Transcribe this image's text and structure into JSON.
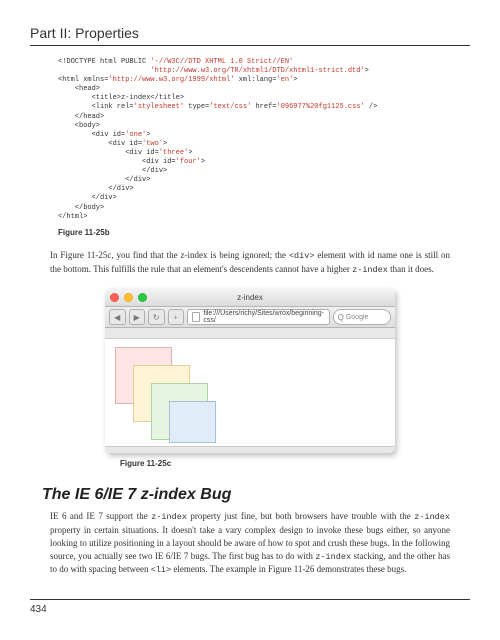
{
  "header": {
    "title": "Part II: Properties"
  },
  "code_listing": {
    "lines": [
      {
        "pre": "<!DOCTYPE html PUBLIC ",
        "str": "'-//W3C//DTD XHTML 1.0 Strict//EN'",
        "post": ""
      },
      {
        "pre": "                      ",
        "str": "'http://www.w3.org/TR/xhtml1/DTD/xhtml1-strict.dtd'",
        "post": ">"
      },
      {
        "pre": "<html xmlns=",
        "str": "'http://www.w3.org/1999/xhtml'",
        "mid": " xml:lang=",
        "str2": "'en'",
        "post": ">"
      },
      {
        "pre": "    <head>",
        "str": "",
        "post": ""
      },
      {
        "pre": "        <title>z-index</title>",
        "str": "",
        "post": ""
      },
      {
        "pre": "        <link rel=",
        "str": "'stylesheet'",
        "mid": " type=",
        "str2": "'text/css'",
        "mid2": " href=",
        "str3": "'096977%20fg1125.css'",
        "post": " />"
      },
      {
        "pre": "    </head>",
        "str": "",
        "post": ""
      },
      {
        "pre": "    <body>",
        "str": "",
        "post": ""
      },
      {
        "pre": "        <div id=",
        "str": "'one'",
        "post": ">"
      },
      {
        "pre": "            <div id=",
        "str": "'two'",
        "post": ">"
      },
      {
        "pre": "                <div id=",
        "str": "'three'",
        "post": ">"
      },
      {
        "pre": "                    <div id=",
        "str": "'four'",
        "post": ">"
      },
      {
        "pre": "                    </div>",
        "str": "",
        "post": ""
      },
      {
        "pre": "                </div>",
        "str": "",
        "post": ""
      },
      {
        "pre": "            </div>",
        "str": "",
        "post": ""
      },
      {
        "pre": "        </div>",
        "str": "",
        "post": ""
      },
      {
        "pre": "    </body>",
        "str": "",
        "post": ""
      },
      {
        "pre": "</html>",
        "str": "",
        "post": ""
      }
    ]
  },
  "captions": {
    "fig_b": "Figure 11-25b",
    "fig_c": "Figure 11-25c"
  },
  "paragraphs": {
    "p1_a": "In Figure 11-25c, you find that the z-index is being ignored; the ",
    "p1_code1": "<div>",
    "p1_b": " element with id name one is still on the bottom. This fulfills the rule that an element's descendents cannot have a higher ",
    "p1_code2": "z-index",
    "p1_c": " than it does.",
    "p2_a": "IE 6 and IE 7 support the ",
    "p2_code1": "z-index",
    "p2_b": " property just fine, but both browsers have trouble with the ",
    "p2_code2": "z-index",
    "p2_c": " property in certain situations. It doesn't take a vary complex design to invoke these bugs either, so anyone looking to utilize positioning in a layout should be aware of how to spot and crush these bugs. In the following source, you actually see two IE 6/IE 7 bugs. The first bug has to do with ",
    "p2_code3": "z-index",
    "p2_d": " stacking, and the other has to do with spacing between ",
    "p2_code4": "<li>",
    "p2_e": " elements. The example in Figure 11-26 demonstrates these bugs."
  },
  "section_heading": "The IE 6/IE 7 z-index Bug",
  "browser": {
    "title": "z-index",
    "address": "file:///Users/richy/Sites/wrox/beginning-css/",
    "search_placeholder": "Google",
    "nav_back": "◀",
    "nav_fwd": "▶",
    "reload": "↻",
    "add": "+",
    "search_icon": "Q"
  },
  "page_number": "434"
}
